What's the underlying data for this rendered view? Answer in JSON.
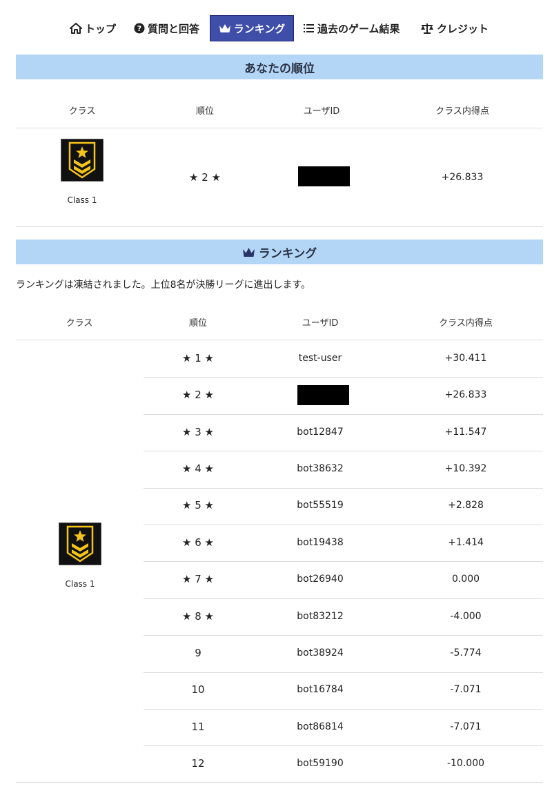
{
  "nav": {
    "items": [
      {
        "label": "トップ",
        "icon": "home-icon",
        "active": false
      },
      {
        "label": "質問と回答",
        "icon": "question-icon",
        "active": false
      },
      {
        "label": "ランキング",
        "icon": "crown-icon",
        "active": true
      },
      {
        "label": "過去のゲーム結果",
        "icon": "list-icon",
        "active": false
      },
      {
        "label": "クレジット",
        "icon": "scale-icon",
        "active": false
      }
    ]
  },
  "my_rank": {
    "title": "あなたの順位",
    "headers": {
      "class": "クラス",
      "rank": "順位",
      "user": "ユーザID",
      "score": "クラス内得点"
    },
    "class_label": "Class 1",
    "rank": "★ 2 ★",
    "score": "+26.833"
  },
  "ranking": {
    "title": "ランキング",
    "notice": "ランキングは凍結されました。上位8名が決勝リーグに進出します。",
    "headers": {
      "class": "クラス",
      "rank": "順位",
      "user": "ユーザID",
      "score": "クラス内得点"
    },
    "class_label": "Class 1",
    "rows": [
      {
        "rank": "★ 1 ★",
        "user": "test-user",
        "score": "+30.411"
      },
      {
        "rank": "★ 2 ★",
        "user": "",
        "score": "+26.833",
        "redacted": true
      },
      {
        "rank": "★ 3 ★",
        "user": "bot12847",
        "score": "+11.547"
      },
      {
        "rank": "★ 4 ★",
        "user": "bot38632",
        "score": "+10.392"
      },
      {
        "rank": "★ 5 ★",
        "user": "bot55519",
        "score": "+2.828"
      },
      {
        "rank": "★ 6 ★",
        "user": "bot19438",
        "score": "+1.414"
      },
      {
        "rank": "★ 7 ★",
        "user": "bot26940",
        "score": "0.000"
      },
      {
        "rank": "★ 8 ★",
        "user": "bot83212",
        "score": "-4.000"
      },
      {
        "rank": "9",
        "user": "bot38924",
        "score": "-5.774"
      },
      {
        "rank": "10",
        "user": "bot16784",
        "score": "-7.071"
      },
      {
        "rank": "11",
        "user": "bot86814",
        "score": "-7.071"
      },
      {
        "rank": "12",
        "user": "bot59190",
        "score": "-10.000"
      }
    ]
  },
  "colors": {
    "accent": "#3f4ea8",
    "header_bg": "#b3d6f7",
    "badge_bg": "#111111",
    "badge_gold": "#f5c518"
  }
}
